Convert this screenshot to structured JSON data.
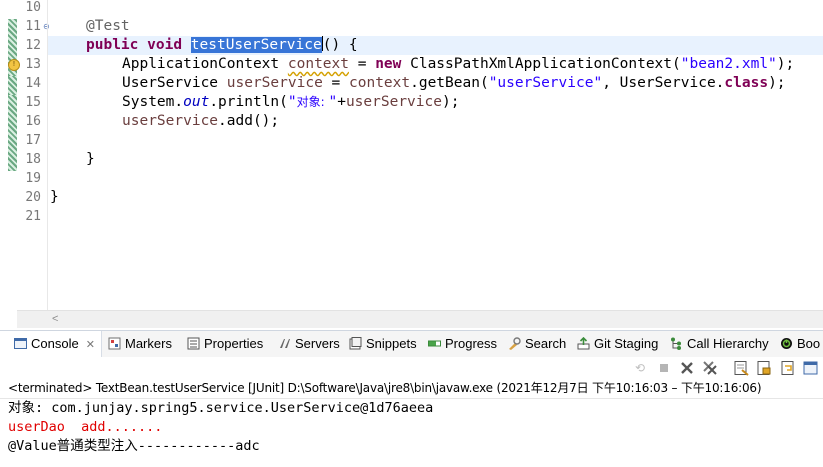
{
  "editor": {
    "line_numbers": [
      "10",
      "11",
      "12",
      "13",
      "14",
      "15",
      "16",
      "17",
      "18",
      "19",
      "20",
      "21"
    ],
    "fold_marker": "⊖",
    "warning_marker": "!",
    "lines": {
      "l11_annotation": "@Test",
      "l12_kw_public": "public",
      "l12_kw_void": "void",
      "l12_method": "testUserService",
      "l12_rest": "() {",
      "l13_type": "ApplicationContext ",
      "l13_var": "context",
      "l13_eq": " = ",
      "l13_kw_new": "new",
      "l13_class": " ClassPathXmlApplicationContext(",
      "l13_str": "\"bean2.xml\"",
      "l13_end": ");",
      "l14_type": "UserService ",
      "l14_var": "userService",
      "l14_eq": " = ",
      "l14_ctx": "context",
      "l14_call": ".getBean(",
      "l14_str": "\"userService\"",
      "l14_mid": ", UserService.",
      "l14_kw_class": "class",
      "l14_end": ");",
      "l15_sys": "System.",
      "l15_field": "out",
      "l15_println": ".println(",
      "l15_str_open": "\"",
      "l15_str_cjk": "对象: ",
      "l15_str_close": "\"",
      "l15_plus": "+",
      "l15_var": "userService",
      "l15_end": ");",
      "l16_var": "userService",
      "l16_call": ".add();",
      "l18_brace": "}",
      "l20_brace": "}"
    },
    "scroll_arrow": "<"
  },
  "console_tabs": [
    {
      "label": "Console",
      "icon": "console-icon",
      "closable": true
    },
    {
      "label": "Markers",
      "icon": "markers-icon"
    },
    {
      "label": "Properties",
      "icon": "properties-icon"
    },
    {
      "label": "Servers",
      "icon": "servers-icon"
    },
    {
      "label": "Snippets",
      "icon": "snippets-icon"
    },
    {
      "label": "Progress",
      "icon": "progress-icon"
    },
    {
      "label": "Search",
      "icon": "search-icon"
    },
    {
      "label": "Git Staging",
      "icon": "git-staging-icon"
    },
    {
      "label": "Call Hierarchy",
      "icon": "call-hierarchy-icon"
    },
    {
      "label": "Boo",
      "icon": "boot-dashboard-icon"
    }
  ],
  "tab_close_glyph": "✕",
  "console": {
    "status": "<terminated> TextBean.testUserService [JUnit] D:\\Software\\Java\\jre8\\bin\\javaw.exe  (2021年12月7日 下午10:16:03 – 下午10:16:06)",
    "output": [
      {
        "text": "对象: com.junjay.spring5.service.UserService@1d76aeea",
        "stream": "out"
      },
      {
        "text": "userDao  add.......",
        "stream": "err"
      },
      {
        "text": "@Value普通类型注入------------adc",
        "stream": "out"
      }
    ]
  },
  "colors": {
    "keyword": "#7f0055",
    "string": "#2a00ff",
    "annotation": "#646464",
    "local_variable": "#6a3e3e",
    "static_field": "#0000c0",
    "selection": "#3875d7",
    "stderr": "#e00000"
  }
}
